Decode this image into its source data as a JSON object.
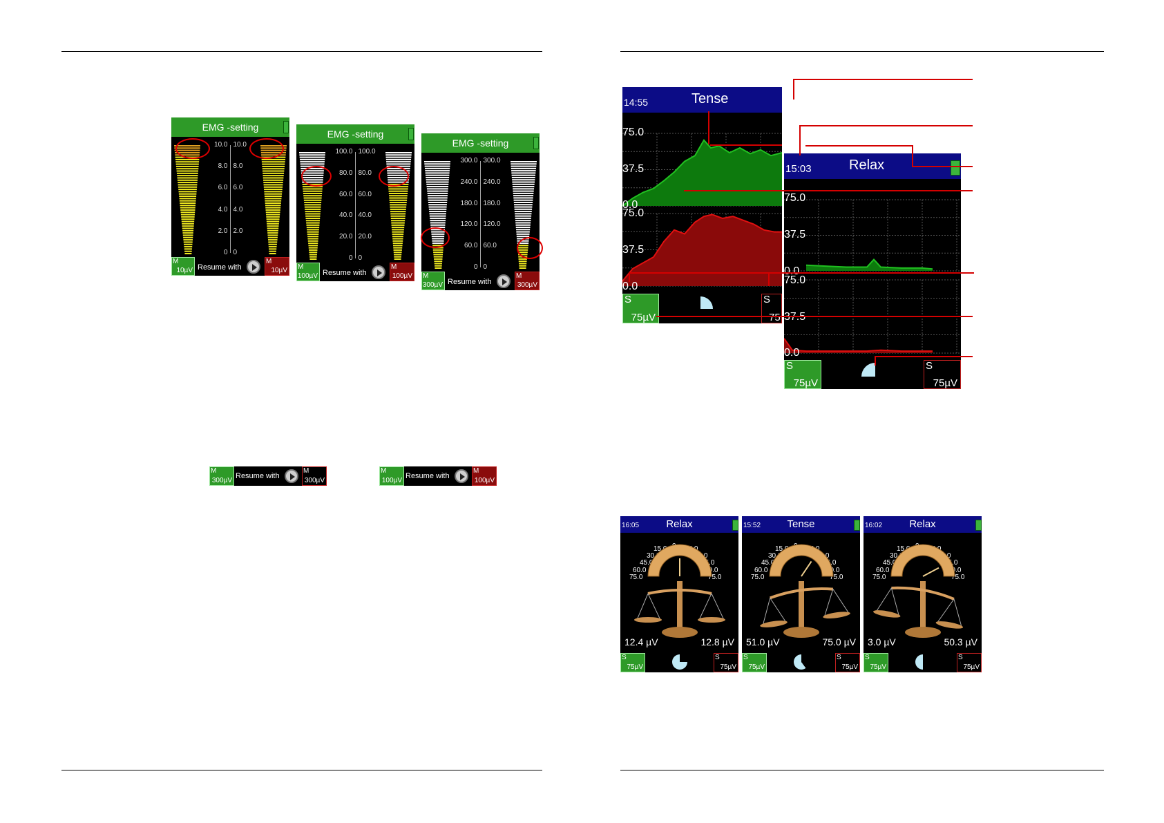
{
  "left_page": {
    "emg_panels": [
      {
        "title": "EMG -setting",
        "ticks": [
          "10.0",
          "8.0",
          "6.0",
          "4.0",
          "2.0",
          "0"
        ],
        "resume_label": "Resume with",
        "left_indicator": {
          "mode": "M",
          "range": "10µV"
        },
        "right_indicator": {
          "mode": "M",
          "range": "10µV"
        }
      },
      {
        "title": "EMG -setting",
        "ticks": [
          "100.0",
          "80.0",
          "60.0",
          "40.0",
          "20.0",
          "0"
        ],
        "resume_label": "Resume with",
        "left_indicator": {
          "mode": "M",
          "range": "100µV"
        },
        "right_indicator": {
          "mode": "M",
          "range": "100µV"
        }
      },
      {
        "title": "EMG -setting",
        "ticks": [
          "300.0",
          "240.0",
          "180.0",
          "120.0",
          "60.0",
          "0"
        ],
        "resume_label": "Resume with",
        "left_indicator": {
          "mode": "M",
          "range": "300µV"
        },
        "right_indicator": {
          "mode": "M",
          "range": "300µV"
        }
      }
    ],
    "resume_bars": [
      {
        "label": "Resume with",
        "left": {
          "mode": "M",
          "range": "300µV"
        },
        "right": {
          "mode": "M",
          "range": "300µV"
        }
      },
      {
        "label": "Resume with",
        "left": {
          "mode": "M",
          "range": "100µV"
        },
        "right": {
          "mode": "M",
          "range": "100µV"
        }
      }
    ]
  },
  "right_page": {
    "tense_screen": {
      "time": "14:55",
      "title": "Tense",
      "y_top": [
        "75.0",
        "37.5",
        "0.0"
      ],
      "y_bottom": [
        "75.0",
        "37.5",
        "0.0"
      ],
      "left_indicator": {
        "mode": "S",
        "range": "75µV"
      },
      "right_indicator": {
        "mode": "S",
        "range": "75"
      }
    },
    "relax_screen": {
      "time": "15:03",
      "title": "Relax",
      "y_top": [
        "75.0",
        "37.5",
        "0.0"
      ],
      "y_bottom": [
        "75.0",
        "37.5",
        "0.0"
      ],
      "left_indicator": {
        "mode": "S",
        "range": "75µV"
      },
      "right_indicator": {
        "mode": "S",
        "range": "75µV"
      }
    },
    "balance_screens": [
      {
        "time": "16:05",
        "title": "Relax",
        "left_value": "12.4 µV",
        "right_value": "12.8 µV",
        "left_indicator": {
          "mode": "S",
          "range": "75µV"
        },
        "right_indicator": {
          "mode": "S",
          "range": "75µV"
        }
      },
      {
        "time": "15:52",
        "title": "Tense",
        "left_value": "51.0 µV",
        "right_value": "75.0 µV",
        "left_indicator": {
          "mode": "S",
          "range": "75µV"
        },
        "right_indicator": {
          "mode": "S",
          "range": "75µV"
        }
      },
      {
        "time": "16:02",
        "title": "Relax",
        "left_value": "3.0 µV",
        "right_value": "50.3 µV",
        "left_indicator": {
          "mode": "S",
          "range": "75µV"
        },
        "right_indicator": {
          "mode": "S",
          "range": "75µV"
        }
      }
    ],
    "dial_ticks": [
      "0",
      "15.0",
      "30.0",
      "45.0",
      "60.0",
      "75.0"
    ]
  },
  "colors": {
    "header_green": "#2e9a28",
    "header_navy": "#0c0c86",
    "callout_red": "#d40000",
    "emg_yellow": "#f0ea20",
    "trace_green": "#20c020",
    "trace_red": "#e01010"
  }
}
